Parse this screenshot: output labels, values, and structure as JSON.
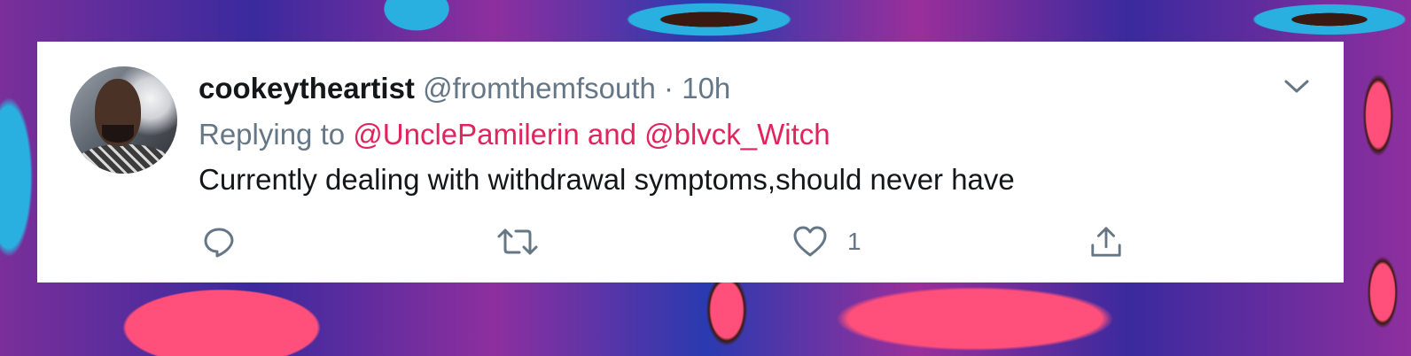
{
  "tweet": {
    "display_name": "cookeytheartist",
    "handle": "@fromthemfsouth",
    "separator": "·",
    "time": "10h",
    "replying_prefix": "Replying to",
    "reply_mentions": "@UnclePamilerin and @blvck_Witch",
    "text": "Currently dealing with withdrawal symptoms,should never have",
    "like_count": "1"
  },
  "icons": {
    "menu": "chevron-down-icon",
    "reply": "reply-bubble-icon",
    "retweet": "retweet-icon",
    "like": "heart-icon",
    "share": "share-icon"
  },
  "colors": {
    "mention": "#e0245e",
    "secondary_text": "#657786",
    "primary_text": "#14171a",
    "card": "#ffffff"
  }
}
